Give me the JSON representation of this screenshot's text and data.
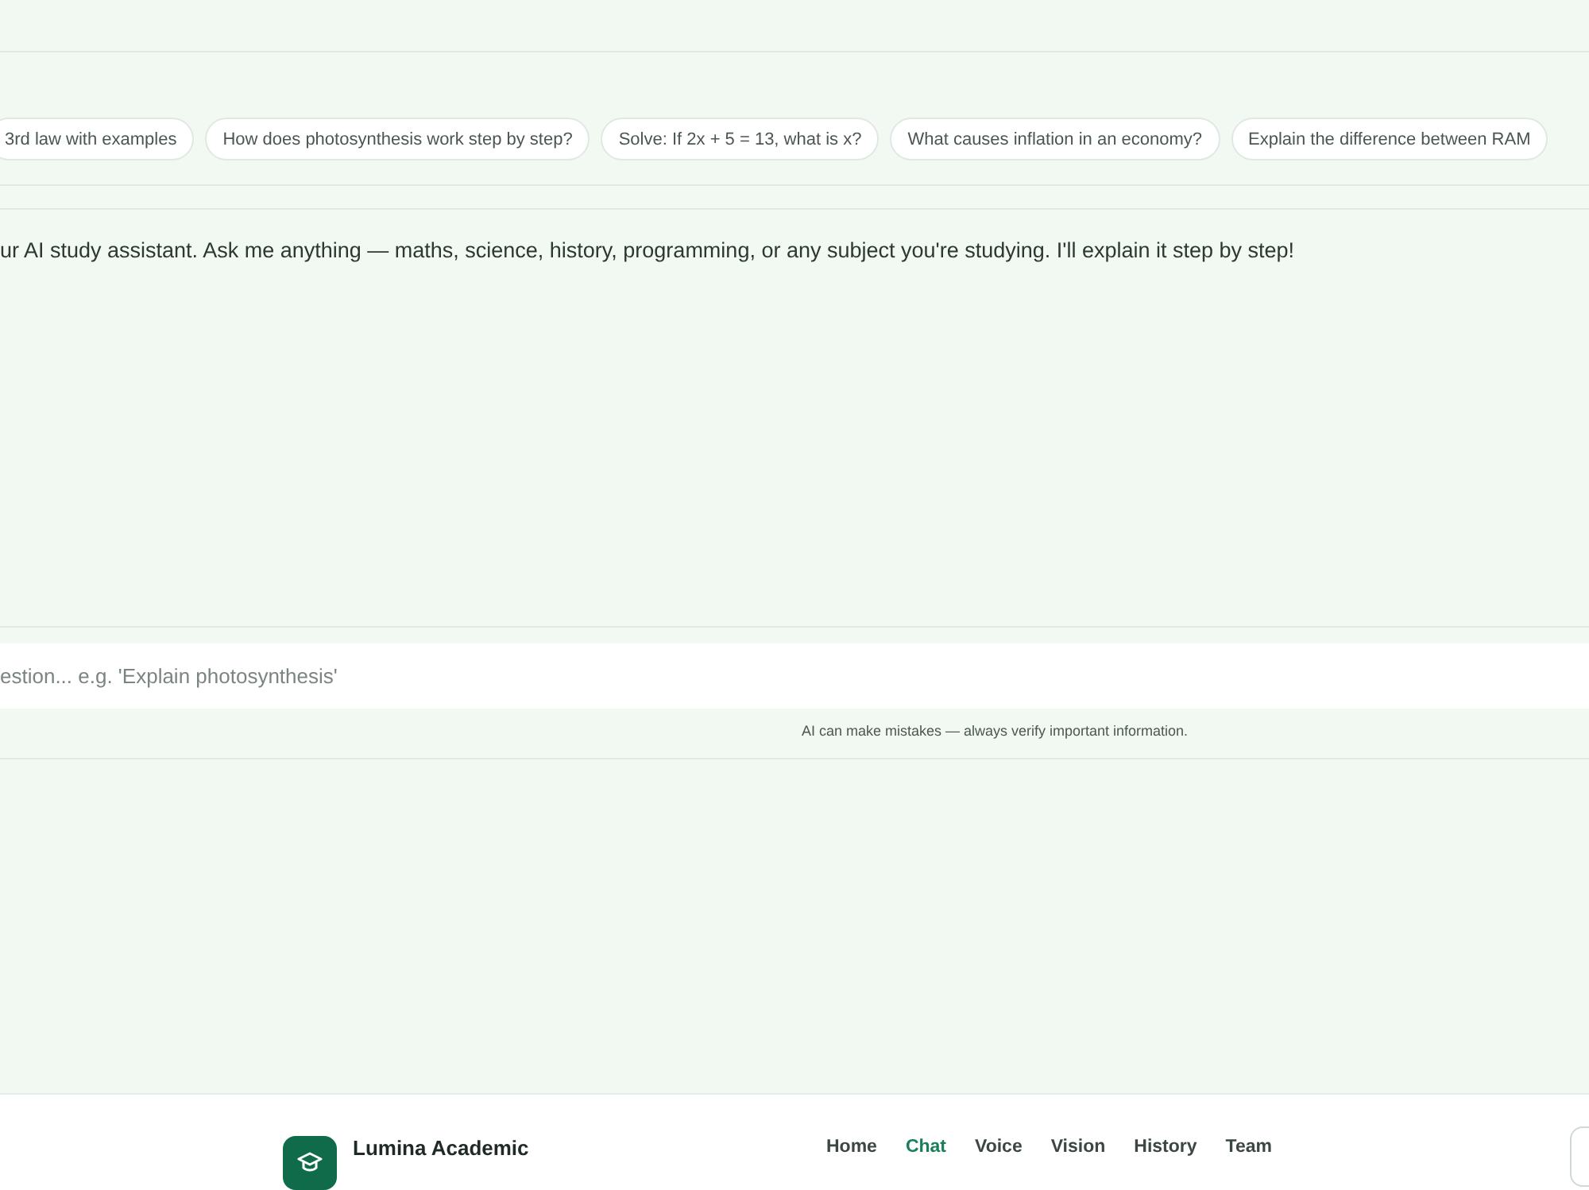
{
  "suggestions": [
    {
      "label": "3rd law with examples"
    },
    {
      "label": "How does photosynthesis work step by step?"
    },
    {
      "label": "Solve: If 2x + 5 = 13, what is x?"
    },
    {
      "label": "What causes inflation in an economy?"
    },
    {
      "label": "Explain the difference between RAM"
    }
  ],
  "welcome_message": "ur AI study assistant. Ask me anything — maths, science, history, programming, or any subject you're studying. I'll explain it step by step!",
  "composer": {
    "placeholder": "estion... e.g. 'Explain photosynthesis'"
  },
  "disclaimer": "AI can make mistakes — always verify important information.",
  "header": {
    "brand": "Lumina Academic",
    "nav": [
      {
        "label": "Home",
        "selected": false
      },
      {
        "label": "Chat",
        "selected": true
      },
      {
        "label": "Voice",
        "selected": false
      },
      {
        "label": "Vision",
        "selected": false
      },
      {
        "label": "History",
        "selected": false
      },
      {
        "label": "Team",
        "selected": false
      }
    ]
  }
}
